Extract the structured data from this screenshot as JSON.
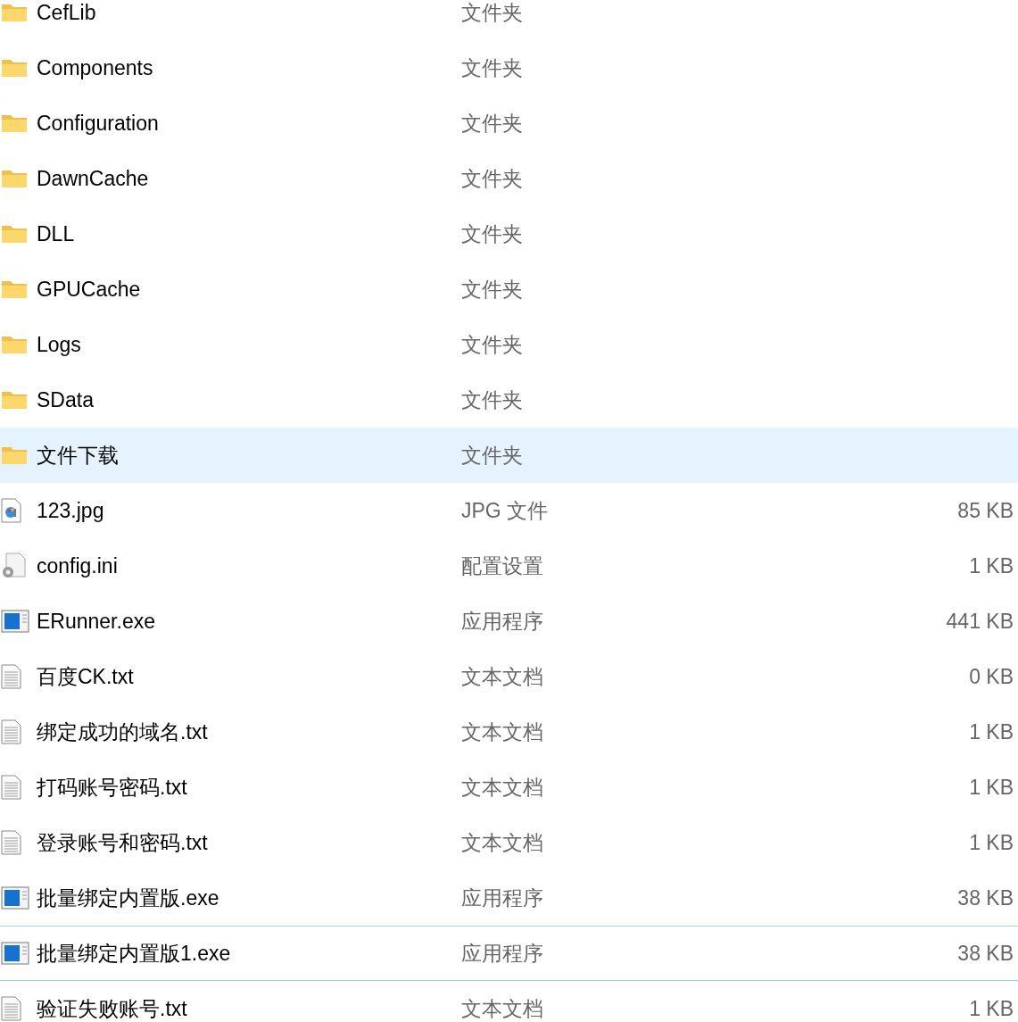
{
  "files": [
    {
      "name": "CefLib",
      "type": "文件夹",
      "kind": "folder",
      "hovered": false,
      "focused": false
    },
    {
      "name": "Components",
      "type": "文件夹",
      "kind": "folder",
      "hovered": false,
      "focused": false
    },
    {
      "name": "Configuration",
      "type": "文件夹",
      "kind": "folder",
      "hovered": false,
      "focused": false
    },
    {
      "name": "DawnCache",
      "type": "文件夹",
      "kind": "folder",
      "hovered": false,
      "focused": false
    },
    {
      "name": "DLL",
      "type": "文件夹",
      "kind": "folder",
      "hovered": false,
      "focused": false
    },
    {
      "name": "GPUCache",
      "type": "文件夹",
      "kind": "folder",
      "hovered": false,
      "focused": false
    },
    {
      "name": "Logs",
      "type": "文件夹",
      "kind": "folder",
      "hovered": false,
      "focused": false
    },
    {
      "name": "SData",
      "type": "文件夹",
      "kind": "folder",
      "hovered": false,
      "focused": false
    },
    {
      "name": "文件下载",
      "type": "文件夹",
      "kind": "folder",
      "hovered": true,
      "focused": false
    },
    {
      "name": "123.jpg",
      "type": "JPG 文件",
      "size": "85 KB",
      "kind": "image",
      "hovered": false,
      "focused": false
    },
    {
      "name": "config.ini",
      "type": "配置设置",
      "size": "1 KB",
      "kind": "config",
      "hovered": false,
      "focused": false
    },
    {
      "name": "ERunner.exe",
      "type": "应用程序",
      "size": "441 KB",
      "kind": "exe",
      "hovered": false,
      "focused": false
    },
    {
      "name": "百度CK.txt",
      "type": "文本文档",
      "size": "0 KB",
      "kind": "text",
      "hovered": false,
      "focused": false
    },
    {
      "name": "绑定成功的域名.txt",
      "type": "文本文档",
      "size": "1 KB",
      "kind": "text",
      "hovered": false,
      "focused": false
    },
    {
      "name": "打码账号密码.txt",
      "type": "文本文档",
      "size": "1 KB",
      "kind": "text",
      "hovered": false,
      "focused": false
    },
    {
      "name": "登录账号和密码.txt",
      "type": "文本文档",
      "size": "1 KB",
      "kind": "text",
      "hovered": false,
      "focused": false
    },
    {
      "name": "批量绑定内置版.exe",
      "type": "应用程序",
      "size": "38 KB",
      "kind": "exe",
      "hovered": false,
      "focused": false
    },
    {
      "name": "批量绑定内置版1.exe",
      "type": "应用程序",
      "size": "38 KB",
      "kind": "exe",
      "hovered": false,
      "focused": true
    },
    {
      "name": "验证失败账号.txt",
      "type": "文本文档",
      "size": "1 KB",
      "kind": "text",
      "hovered": false,
      "focused": false
    }
  ]
}
